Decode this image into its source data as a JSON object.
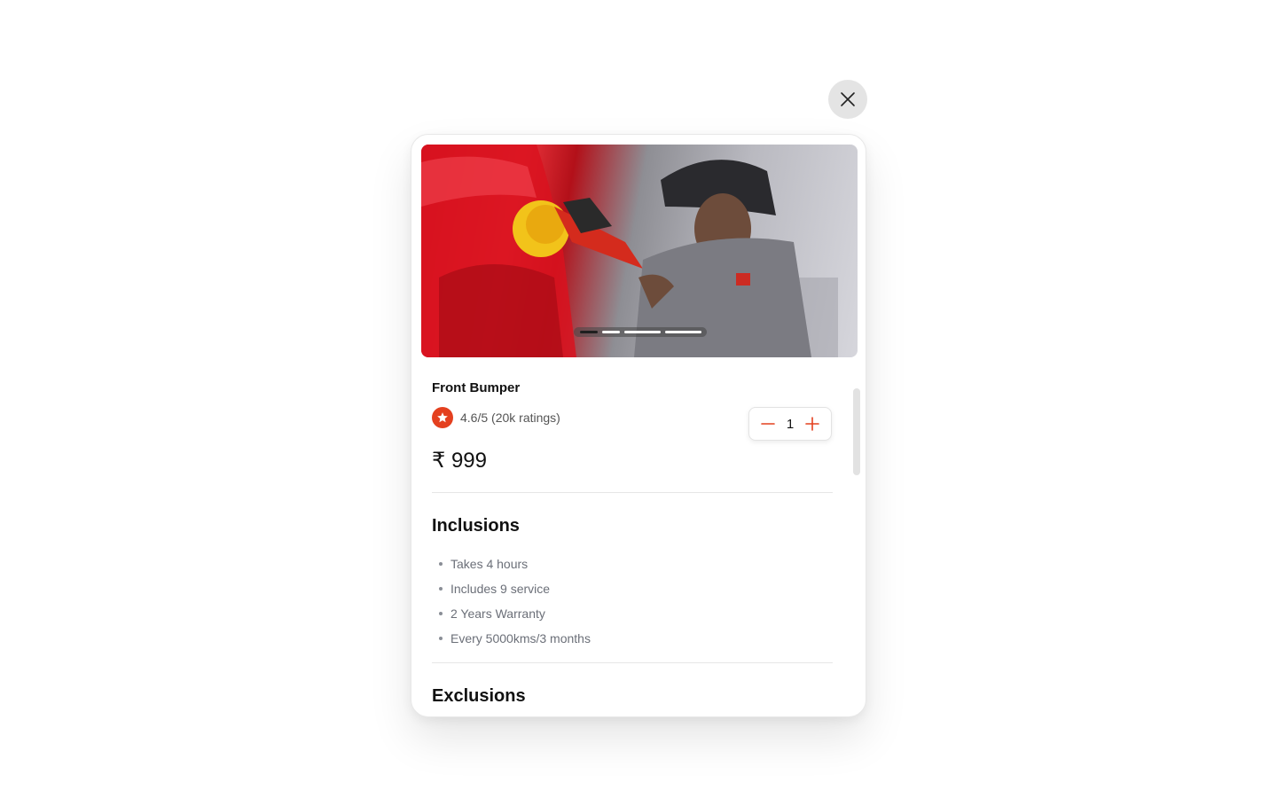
{
  "close_button": {
    "icon": "close-icon"
  },
  "service": {
    "image_alt": "Technician polishing a red car with a FLEX polisher",
    "carousel": {
      "total": 3,
      "active_index": 0
    },
    "title": "Front Bumper",
    "rating_text": "4.6/5 (20k ratings)",
    "rating_icon": "star-icon",
    "price": "₹ 999",
    "quantity": "1",
    "accent_color": "#e4401f"
  },
  "inclusions": {
    "title": "Inclusions",
    "items": [
      "Takes 4 hours",
      "Includes 9 service",
      "2 Years Warranty",
      "Every 5000kms/3 months"
    ]
  },
  "exclusions": {
    "title": "Exclusions"
  }
}
